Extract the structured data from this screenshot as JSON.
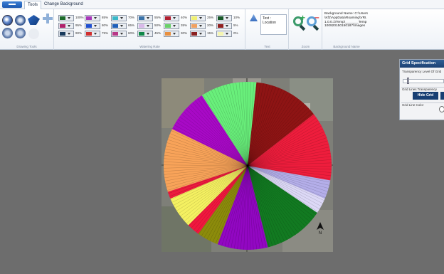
{
  "tabs": [
    {
      "label": "Tools",
      "active": true
    },
    {
      "label": "Change Background",
      "active": false
    }
  ],
  "ribbon": {
    "drawing_tools_label": "Drawing Tools",
    "watering_rate_label": "Watering Rate",
    "text_label": "Text",
    "zoom_label": "Zoom",
    "background_name_label": "Background Name",
    "text_box_value": "Text : Location",
    "background_name_value": "Background Name: C:\\Users\\Kf2\\AppData\\Roaming\\VRI.1.0.0.1\\Temp\\_______Temp100920150150187\\Images",
    "swatches": [
      {
        "pct": "100%",
        "color": "#1d6b2a"
      },
      {
        "pct": "95%",
        "color": "#b0206a"
      },
      {
        "pct": "90%",
        "color": "#183a5c"
      },
      {
        "pct": "85%",
        "color": "#a838b8"
      },
      {
        "pct": "80%",
        "color": "#2050d0"
      },
      {
        "pct": "75%",
        "color": "#d03030"
      },
      {
        "pct": "70%",
        "color": "#3ab8c8"
      },
      {
        "pct": "65%",
        "color": "#1f5fb8"
      },
      {
        "pct": "60%",
        "color": "#b83888"
      },
      {
        "pct": "55%",
        "color": "#3a72a8"
      },
      {
        "pct": "50%",
        "color": "#d8b8e8"
      },
      {
        "pct": "45%",
        "color": "#108848"
      },
      {
        "pct": "40%",
        "color": "#b02030"
      },
      {
        "pct": "35%",
        "color": "#6ad06a"
      },
      {
        "pct": "30%",
        "color": "#e89040"
      },
      {
        "pct": "25%",
        "color": "#f0f070"
      },
      {
        "pct": "20%",
        "color": "#f0a060"
      },
      {
        "pct": "15%",
        "color": "#8a2020"
      },
      {
        "pct": "10%",
        "color": "#185828"
      },
      {
        "pct": "5%",
        "color": "#902020"
      },
      {
        "pct": "0%",
        "color": "#f6f6b0"
      }
    ]
  },
  "pie_sectors": [
    {
      "start": 6,
      "end": 52,
      "color": "#8e1414"
    },
    {
      "start": 52,
      "end": 100,
      "color": "#ee1d3c"
    },
    {
      "start": 100,
      "end": 113,
      "color": "#b4aee9"
    },
    {
      "start": 113,
      "end": 124,
      "color": "#dcd8f6"
    },
    {
      "start": 124,
      "end": 166,
      "color": "#127a21"
    },
    {
      "start": 166,
      "end": 201,
      "color": "#9207c2"
    },
    {
      "start": 201,
      "end": 216,
      "color": "#8c8b0b"
    },
    {
      "start": 216,
      "end": 225,
      "color": "#f0173e"
    },
    {
      "start": 225,
      "end": 247,
      "color": "#f4f061"
    },
    {
      "start": 247,
      "end": 252,
      "color": "#ec1a3e"
    },
    {
      "start": 252,
      "end": 296,
      "color": "#f8a359"
    },
    {
      "start": 296,
      "end": 327,
      "color": "#a809c6"
    },
    {
      "start": 327,
      "end": 360,
      "color": "#69ef7b"
    },
    {
      "start": 0,
      "end": 6,
      "color": "#69ef7b"
    }
  ],
  "grid_panel": {
    "title": "Grid Specification",
    "transparency_label": "Transparency Level Of Grid",
    "transparency_value": 0.1,
    "grid_lines_label": "Grid Lines Transparency",
    "hide_grid_button": "Hide Grid",
    "grid_line_color_label": "Grid Line Color"
  },
  "north_label": "N"
}
